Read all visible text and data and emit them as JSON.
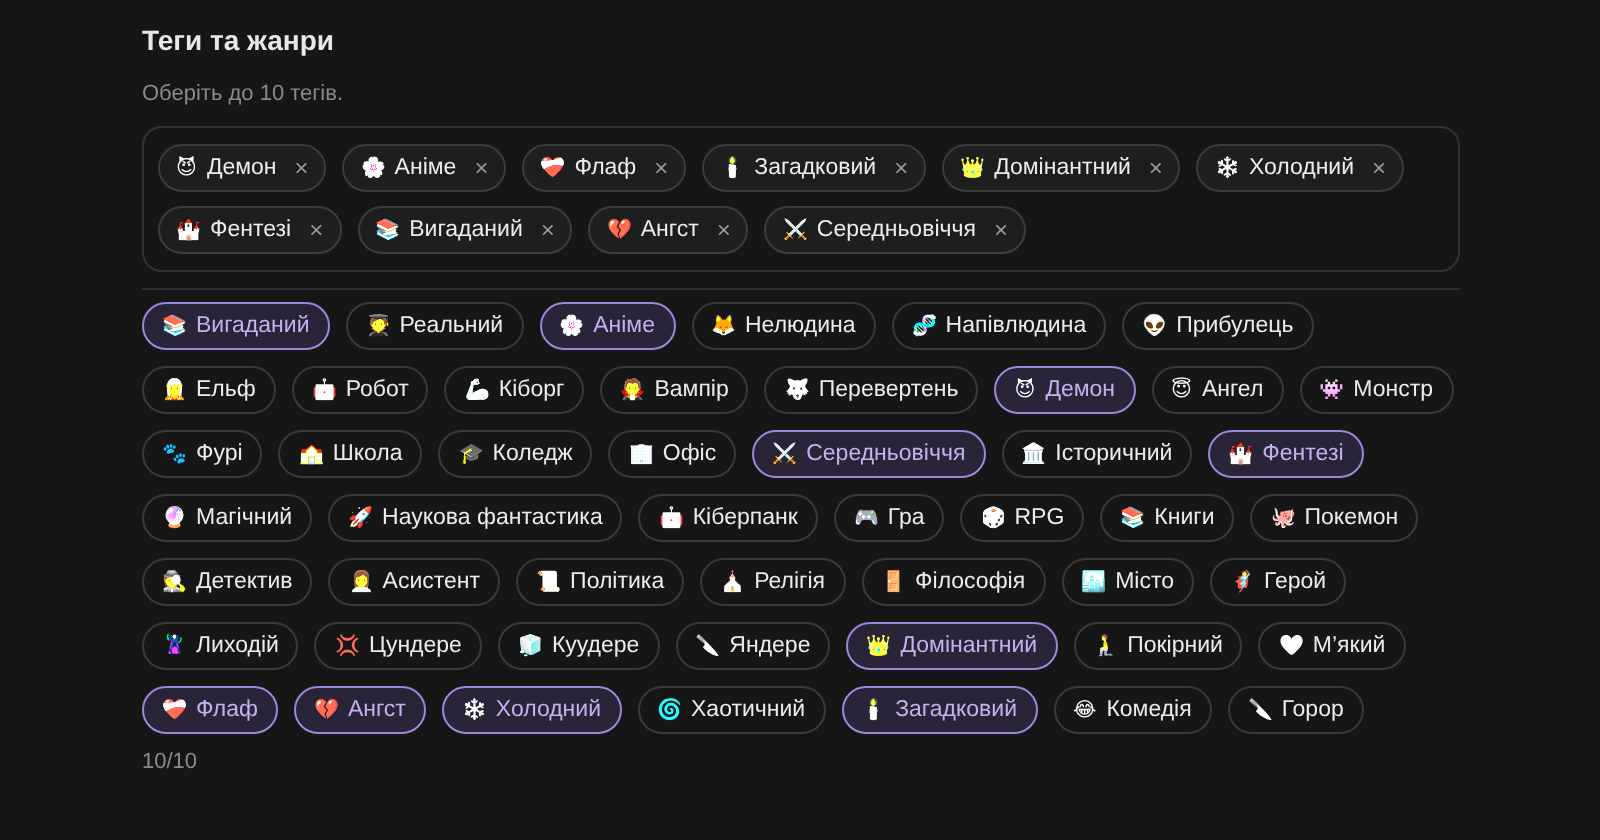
{
  "title": "Теги та жанри",
  "hint": "Оберіть до 10 тегів.",
  "chosen": [
    {
      "emoji": "😈",
      "label": "Демон",
      "remove": "×"
    },
    {
      "emoji": "🌸",
      "label": "Аніме",
      "remove": "×"
    },
    {
      "emoji": "❤️‍🩹",
      "label": "Флаф",
      "remove": "×"
    },
    {
      "emoji": "🕯️",
      "label": "Загадковий",
      "remove": "×"
    },
    {
      "emoji": "👑",
      "label": "Домінантний",
      "remove": "×"
    },
    {
      "emoji": "❄️",
      "label": "Холодний",
      "remove": "×"
    },
    {
      "emoji": "🏰",
      "label": "Фентезі",
      "remove": "×"
    },
    {
      "emoji": "📚",
      "label": "Вигаданий",
      "remove": "×"
    },
    {
      "emoji": "💔",
      "label": "Ангст",
      "remove": "×"
    },
    {
      "emoji": "⚔️",
      "label": "Середньовіччя",
      "remove": "×"
    }
  ],
  "tags": [
    {
      "emoji": "📚",
      "label": "Вигаданий",
      "selected": true
    },
    {
      "emoji": "🧑‍🎓",
      "label": "Реальний",
      "selected": false
    },
    {
      "emoji": "🌸",
      "label": "Аніме",
      "selected": true
    },
    {
      "emoji": "🦊",
      "label": "Нелюдина",
      "selected": false
    },
    {
      "emoji": "🧬",
      "label": "Напівлюдина",
      "selected": false
    },
    {
      "emoji": "👽",
      "label": "Прибулець",
      "selected": false
    },
    {
      "emoji": "🧝",
      "label": "Ельф",
      "selected": false
    },
    {
      "emoji": "🤖",
      "label": "Робот",
      "selected": false
    },
    {
      "emoji": "🦾",
      "label": "Кіборг",
      "selected": false
    },
    {
      "emoji": "🧛",
      "label": "Вампір",
      "selected": false
    },
    {
      "emoji": "🐺",
      "label": "Перевертень",
      "selected": false
    },
    {
      "emoji": "😈",
      "label": "Демон",
      "selected": true
    },
    {
      "emoji": "😇",
      "label": "Ангел",
      "selected": false
    },
    {
      "emoji": "👾",
      "label": "Монстр",
      "selected": false
    },
    {
      "emoji": "🐾",
      "label": "Фурі",
      "selected": false
    },
    {
      "emoji": "🏫",
      "label": "Школа",
      "selected": false
    },
    {
      "emoji": "🎓",
      "label": "Коледж",
      "selected": false
    },
    {
      "emoji": "🏢",
      "label": "Офіс",
      "selected": false
    },
    {
      "emoji": "⚔️",
      "label": "Середньовіччя",
      "selected": true
    },
    {
      "emoji": "🏛️",
      "label": "Історичний",
      "selected": false
    },
    {
      "emoji": "🏰",
      "label": "Фентезі",
      "selected": true
    },
    {
      "emoji": "🔮",
      "label": "Магічний",
      "selected": false
    },
    {
      "emoji": "🚀",
      "label": "Наукова фантастика",
      "selected": false
    },
    {
      "emoji": "🤖",
      "label": "Кіберпанк",
      "selected": false
    },
    {
      "emoji": "🎮",
      "label": "Гра",
      "selected": false
    },
    {
      "emoji": "🎲",
      "label": "RPG",
      "selected": false
    },
    {
      "emoji": "📚",
      "label": "Книги",
      "selected": false
    },
    {
      "emoji": "🐙",
      "label": "Покемон",
      "selected": false
    },
    {
      "emoji": "🕵️",
      "label": "Детектив",
      "selected": false
    },
    {
      "emoji": "👩‍💼",
      "label": "Асистент",
      "selected": false
    },
    {
      "emoji": "📜",
      "label": "Політика",
      "selected": false
    },
    {
      "emoji": "⛪",
      "label": "Релігія",
      "selected": false
    },
    {
      "emoji": "🚪",
      "label": "Філософія",
      "selected": false
    },
    {
      "emoji": "🏙️",
      "label": "Місто",
      "selected": false
    },
    {
      "emoji": "🦸",
      "label": "Герой",
      "selected": false
    },
    {
      "emoji": "🦹",
      "label": "Лиходій",
      "selected": false
    },
    {
      "emoji": "💢",
      "label": "Цундере",
      "selected": false
    },
    {
      "emoji": "🧊",
      "label": "Куудере",
      "selected": false
    },
    {
      "emoji": "🔪",
      "label": "Яндере",
      "selected": false
    },
    {
      "emoji": "👑",
      "label": "Домінантний",
      "selected": true
    },
    {
      "emoji": "🧎",
      "label": "Покірний",
      "selected": false
    },
    {
      "emoji": "🤍",
      "label": "М’який",
      "selected": false
    },
    {
      "emoji": "❤️‍🩹",
      "label": "Флаф",
      "selected": true
    },
    {
      "emoji": "💔",
      "label": "Ангст",
      "selected": true
    },
    {
      "emoji": "❄️",
      "label": "Холодний",
      "selected": true
    },
    {
      "emoji": "🌀",
      "label": "Хаотичний",
      "selected": false
    },
    {
      "emoji": "🕯️",
      "label": "Загадковий",
      "selected": true
    },
    {
      "emoji": "😂",
      "label": "Комедія",
      "selected": false
    },
    {
      "emoji": "🔪",
      "label": "Горор",
      "selected": false
    }
  ],
  "counter": "10/10"
}
